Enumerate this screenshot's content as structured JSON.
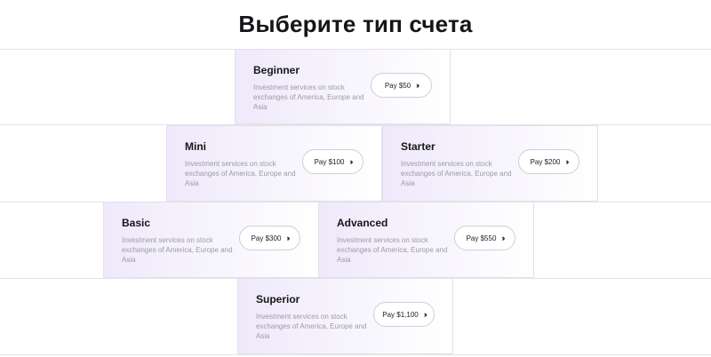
{
  "heading": "Выберите тип счета",
  "cards": [
    {
      "name": "Beginner",
      "description": "Investment services on stock exchanges of America, Europe and Asia",
      "button": "Pay $50",
      "button_icon": "double-chevron-right-icon"
    },
    {
      "name": "Mini",
      "description": "Investment services on stock exchanges of America, Europe and Asia",
      "button": "Pay $100",
      "button_icon": "double-chevron-right-icon"
    },
    {
      "name": "Starter",
      "description": "Investment services on stock exchanges of America, Europe and Asia",
      "button": "Pay $200",
      "button_icon": "double-chevron-right-icon"
    },
    {
      "name": "Basic",
      "description": "Investment services on stock exchanges of America, Europe and Asia",
      "button": "Pay $300",
      "button_icon": "double-chevron-right-icon"
    },
    {
      "name": "Advanced",
      "description": "Investment services on stock exchanges of America, Europe and Asia",
      "button": "Pay $550",
      "button_icon": "double-chevron-right-icon"
    },
    {
      "name": "Superior",
      "description": "Investment services on stock exchanges of America, Europe and Asia",
      "button": "Pay $1,100",
      "button_icon": "double-chevron-right-icon"
    }
  ],
  "colors": {
    "card_gradient_start": "#efe9fb",
    "card_border": "#e2e0ea",
    "button_border": "#cfcdd8",
    "description_text": "#9c9aa8"
  }
}
